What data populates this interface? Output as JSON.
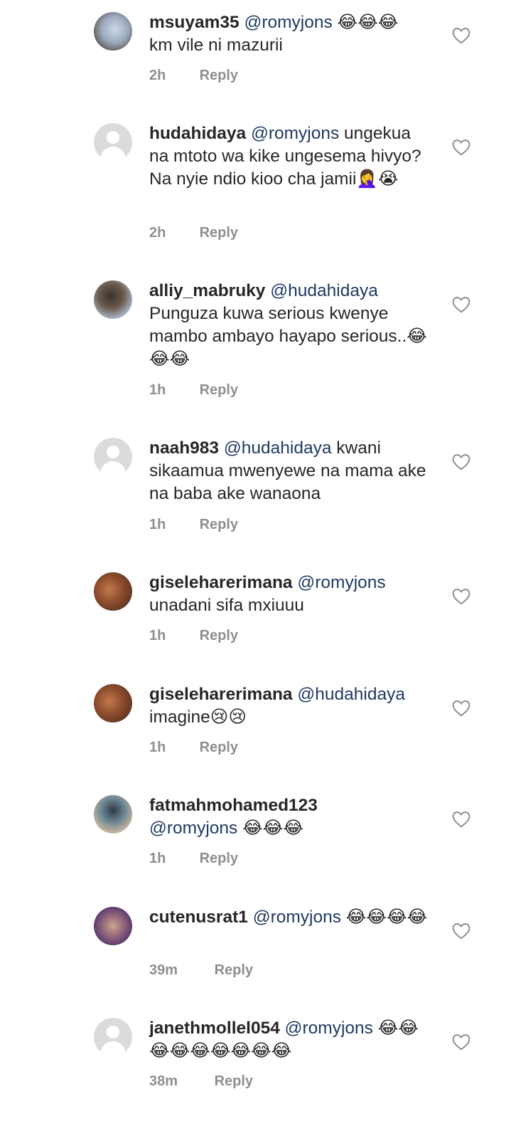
{
  "comments": [
    {
      "username": "msuyam35",
      "mention": "@romyjons",
      "text": " 😂😂😂",
      "line2": "km vile ni mazurii",
      "time": "2h",
      "reply": "Reply"
    },
    {
      "username": "hudahidaya",
      "mention": "@romyjons",
      "text": " ungekua na mtoto wa kike ungesema hivyo? Na nyie ndio kioo cha jamii🤦‍♀️😭",
      "time": "2h",
      "reply": "Reply"
    },
    {
      "username": "alliy_mabruky",
      "mention": "@hudahidaya",
      "text": " Punguza kuwa serious kwenye mambo ambayo hayapo serious..😂😂😂",
      "time": "1h",
      "reply": "Reply"
    },
    {
      "username": "naah983",
      "mention": "@hudahidaya",
      "text": " kwani sikaamua mwenyewe na mama ake na baba ake wanaona",
      "time": "1h",
      "reply": "Reply"
    },
    {
      "username": "giseleharerimana",
      "mention": "@romyjons",
      "text": " unadani sifa mxiuuu",
      "time": "1h",
      "reply": "Reply"
    },
    {
      "username": "giseleharerimana",
      "mention": "@hudahidaya",
      "text": " imagine😢😢",
      "time": "1h",
      "reply": "Reply"
    },
    {
      "username": "fatmahmohamed123",
      "mention": "@romyjons",
      "text": " 😂😂😂",
      "time": "1h",
      "reply": "Reply"
    },
    {
      "username": "cutenusrat1",
      "mention": "@romyjons",
      "text": " 😂😂😂😂",
      "time": "39m",
      "reply": "Reply"
    },
    {
      "username": "janethmollel054",
      "mention": "@romyjons",
      "text": " 😂😂😂😂😂😂😂😂😂",
      "time": "38m",
      "reply": "Reply"
    }
  ]
}
